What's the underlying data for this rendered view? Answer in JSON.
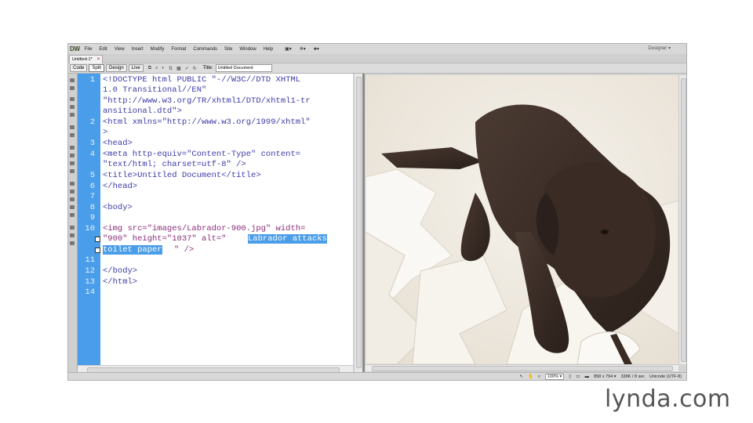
{
  "app": {
    "logo": "DW",
    "menus": [
      "File",
      "Edit",
      "View",
      "Insert",
      "Modify",
      "Format",
      "Commands",
      "Site",
      "Window",
      "Help"
    ],
    "workspace": "Designer ▾"
  },
  "document_tab": {
    "name": "Untitled-1*",
    "close": "×"
  },
  "toolbar": {
    "views": [
      "Code",
      "Split",
      "Design",
      "Live"
    ],
    "active_view": "Split",
    "title_label": "Title:",
    "title_value": "Untitled Document"
  },
  "code": {
    "line_numbers": [
      "1",
      "2",
      "3",
      "4",
      "5",
      "6",
      "7",
      "8",
      "9",
      "10",
      "11",
      "12",
      "13",
      "14"
    ],
    "lines": [
      "<!DOCTYPE html PUBLIC \"-//W3C//DTD XHTML",
      "1.0 Transitional//EN\"",
      "\"http://www.w3.org/TR/xhtml1/DTD/xhtml1-tr",
      "ansitional.dtd\">",
      "<html xmlns=\"http://www.w3.org/1999/xhtml\"",
      ">",
      "<head>",
      "<meta http-equiv=\"Content-Type\" content=",
      "\"text/html; charset=utf-8\" />",
      "<title>Untitled Document</title>",
      "</head>",
      "",
      "<body>",
      "",
      "<img src=\"images/Labrador-900.jpg\" width=",
      "\"900\" height=\"1037\" alt=\"",
      "Labrador attacks",
      "toilet paper",
      "\" />",
      "",
      "</body>",
      "</html>"
    ]
  },
  "statusbar": {
    "zoom": "100% ▾",
    "dimensions": "858 x 794 ▾",
    "size": "338K / 8 sec",
    "encoding": "Unicode (UTF-8)"
  },
  "watermark": "lynda.com"
}
